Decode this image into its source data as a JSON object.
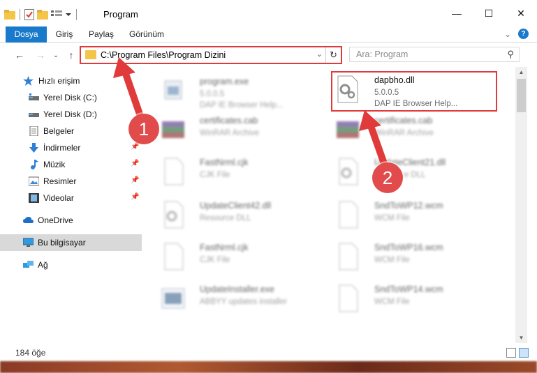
{
  "window": {
    "title": "Program",
    "minimize_glyph": "—",
    "maximize_glyph": "☐",
    "close_glyph": "✕"
  },
  "ribbon": {
    "tabs": [
      {
        "label": "Dosya"
      },
      {
        "label": "Giriş"
      },
      {
        "label": "Paylaş"
      },
      {
        "label": "Görünüm"
      }
    ],
    "help_glyph": "?",
    "collapse_glyph": "⌄"
  },
  "navigation": {
    "back_glyph": "←",
    "forward_glyph": "→",
    "recent_glyph": "⌄",
    "up_glyph": "↑",
    "address_path": "C:\\Program Files\\Program Dizini",
    "address_dropdown_glyph": "⌄",
    "refresh_glyph": "↻",
    "search_placeholder": "Ara: Program",
    "search_glyph": "⚲"
  },
  "sidebar": {
    "items": [
      {
        "label": "Hızlı erişim",
        "icon": "star-icon",
        "pinned": false
      },
      {
        "label": "Yerel Disk (C:)",
        "icon": "drive-icon",
        "pinned": true
      },
      {
        "label": "Yerel Disk (D:)",
        "icon": "drive-icon",
        "pinned": true
      },
      {
        "label": "Belgeler",
        "icon": "documents-icon",
        "pinned": true
      },
      {
        "label": "İndirmeler",
        "icon": "download-icon",
        "pinned": true
      },
      {
        "label": "Müzik",
        "icon": "music-icon",
        "pinned": true
      },
      {
        "label": "Resimler",
        "icon": "pictures-icon",
        "pinned": true
      },
      {
        "label": "Videolar",
        "icon": "videos-icon",
        "pinned": true
      },
      {
        "label": "OneDrive",
        "icon": "cloud-icon",
        "pinned": false
      },
      {
        "label": "Bu bilgisayar",
        "icon": "computer-icon",
        "pinned": false,
        "selected": true
      },
      {
        "label": "Ağ",
        "icon": "network-icon",
        "pinned": false
      }
    ],
    "pin_glyph": "📌"
  },
  "files": [
    {
      "name": "program.exe",
      "line2": "5.0.0.5",
      "line3": "DAP IE Browser Help...",
      "icon": "exe-icon",
      "blurred": true
    },
    {
      "name": "dapbho.dll",
      "line2": "5.0.0.5",
      "line3": "DAP IE Browser Help...",
      "icon": "dll-gear-icon",
      "blurred": false
    },
    {
      "name": "certificates.cab",
      "line2": "WinRAR Archive",
      "line3": "",
      "icon": "winrar-icon",
      "blurred": true
    },
    {
      "name": "certificates.cab",
      "line2": "WinRAR Archive",
      "line3": "",
      "icon": "winrar-icon",
      "blurred": true
    },
    {
      "name": "FastNrml.cjk",
      "line2": "CJK File",
      "line3": "",
      "icon": "file-icon",
      "blurred": true
    },
    {
      "name": "UpdateClient21.dll",
      "line2": "Resource DLL",
      "line3": "",
      "icon": "dll-gear-icon",
      "blurred": true
    },
    {
      "name": "UpdateClient42.dll",
      "line2": "Resource DLL",
      "line3": "",
      "icon": "dll-gear-icon",
      "blurred": true
    },
    {
      "name": "SndToWP12.wcm",
      "line2": "WCM File",
      "line3": "",
      "icon": "file-icon",
      "blurred": true
    },
    {
      "name": "FastNrml.cjk",
      "line2": "CJK File",
      "line3": "",
      "icon": "file-icon",
      "blurred": true
    },
    {
      "name": "SndToWP16.wcm",
      "line2": "WCM File",
      "line3": "",
      "icon": "file-icon",
      "blurred": true
    },
    {
      "name": "UpdateInstaller.exe",
      "line2": "ABBYY updates installer",
      "line3": "",
      "icon": "installer-icon",
      "blurred": true
    },
    {
      "name": "SndToWP14.wcm",
      "line2": "WCM File",
      "line3": "",
      "icon": "file-icon",
      "blurred": true
    }
  ],
  "status": {
    "item_count": "184 öğe"
  },
  "annotations": {
    "step1": "1",
    "step2": "2",
    "marker_color": "#e03a3a"
  }
}
